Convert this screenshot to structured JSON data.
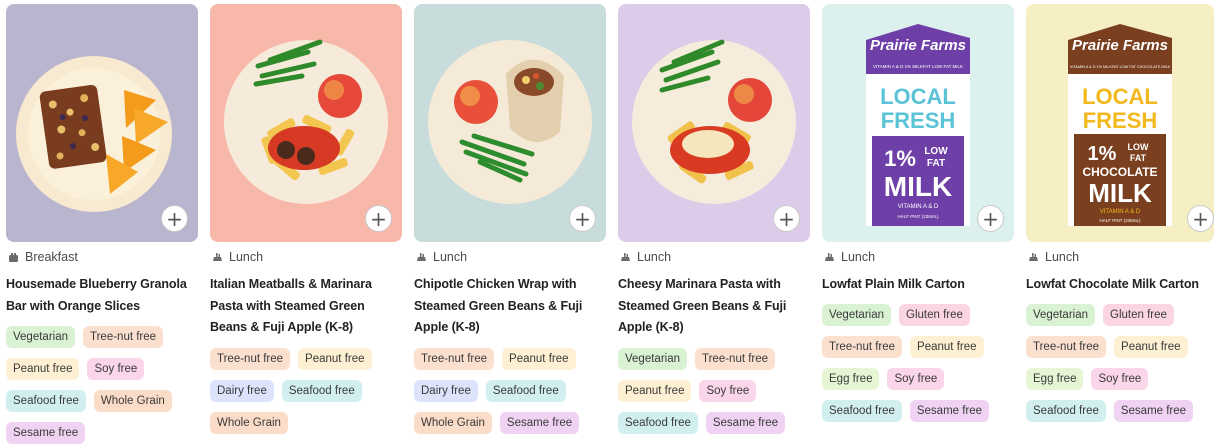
{
  "icons": {
    "add": "plus-icon",
    "breakfast": "toaster-icon",
    "lunch": "tray-icon"
  },
  "add_label": "+",
  "cards": [
    {
      "meal": "Breakfast",
      "title": "Housemade Blueberry Granola Bar with Orange Slices",
      "bg": "#b9b5cf",
      "tags": [
        "Vegetarian",
        "Tree-nut free",
        "Peanut free",
        "Soy free",
        "Seafood free",
        "Whole Grain",
        "Sesame free"
      ]
    },
    {
      "meal": "Lunch",
      "title": "Italian Meatballs & Marinara Pasta with Steamed Green Beans & Fuji Apple (K-8)",
      "bg": "#f7b8aa",
      "tags": [
        "Tree-nut free",
        "Peanut free",
        "Dairy free",
        "Seafood free",
        "Whole Grain"
      ]
    },
    {
      "meal": "Lunch",
      "title": "Chipotle Chicken Wrap with Steamed Green Beans & Fuji Apple (K-8)",
      "bg": "#c9dcdc",
      "tags": [
        "Tree-nut free",
        "Peanut free",
        "Dairy free",
        "Seafood free",
        "Whole Grain",
        "Sesame free"
      ]
    },
    {
      "meal": "Lunch",
      "title": "Cheesy Marinara Pasta with Steamed Green Beans & Fuji Apple (K-8)",
      "bg": "#dccbe9",
      "tags": [
        "Vegetarian",
        "Tree-nut free",
        "Peanut free",
        "Soy free",
        "Seafood free",
        "Sesame free"
      ]
    },
    {
      "meal": "Lunch",
      "title": "Lowfat Plain Milk Carton",
      "bg": "#dcf1ee",
      "carton": {
        "brand": "Prairie Farms",
        "top": "VITAMIN A & D  1% MILKFAT  LOW FAT MILK",
        "local": "LOCAL",
        "fresh": "FRESH",
        "pct": "1%",
        "low": "LOW",
        "fat": "FAT",
        "kind": "",
        "milk": "MILK",
        "vit": "VITAMIN A & D",
        "size": "HALF PINT (236mL)"
      },
      "tags": [
        "Vegetarian",
        "Gluten free",
        "Tree-nut free",
        "Peanut free",
        "Egg free",
        "Soy free",
        "Seafood free",
        "Sesame free"
      ]
    },
    {
      "meal": "Lunch",
      "title": "Lowfat Chocolate Milk Carton",
      "bg": "#f6efc3",
      "carton": {
        "brand": "Prairie Farms",
        "top": "VITAMIN A & D  1% MILKFAT  LOW FAT CHOCOLATE MILK",
        "local": "LOCAL",
        "fresh": "FRESH",
        "pct": "1%",
        "low": "LOW",
        "fat": "FAT",
        "kind": "CHOCOLATE",
        "milk": "MILK",
        "vit": "VITAMIN A & D",
        "size": "HALF PINT (236mL)"
      },
      "tags": [
        "Vegetarian",
        "Gluten free",
        "Tree-nut free",
        "Peanut free",
        "Egg free",
        "Soy free",
        "Seafood free",
        "Sesame free"
      ]
    }
  ]
}
